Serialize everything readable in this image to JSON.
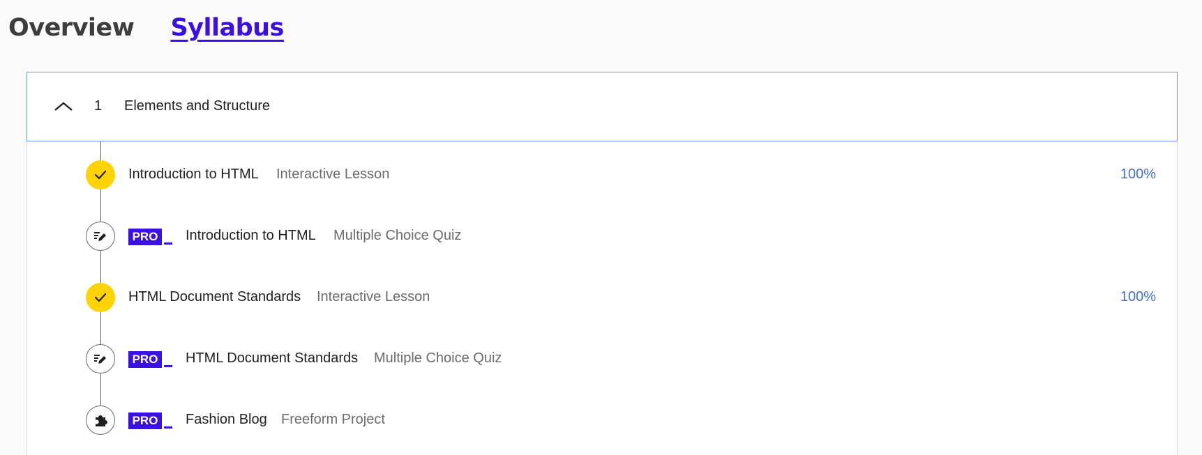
{
  "tabs": [
    {
      "label": "Overview"
    },
    {
      "label": "Syllabus"
    }
  ],
  "module": {
    "number": "1",
    "title": "Elements and Structure"
  },
  "items": [
    {
      "status": "done",
      "pro": false,
      "title": "Introduction to HTML",
      "type": "Interactive Lesson",
      "progress": "100%"
    },
    {
      "status": "quiz",
      "pro": true,
      "pro_label": "PRO",
      "title": "Introduction to HTML",
      "type": "Multiple Choice Quiz"
    },
    {
      "status": "done",
      "pro": false,
      "title": "HTML Document Standards",
      "type": "Interactive Lesson",
      "progress": "100%"
    },
    {
      "status": "quiz",
      "pro": true,
      "pro_label": "PRO",
      "title": "HTML Document Standards",
      "type": "Multiple Choice Quiz"
    },
    {
      "status": "project",
      "pro": true,
      "pro_label": "PRO",
      "title": "Fashion Blog",
      "type": "Freeform Project"
    }
  ],
  "colors": {
    "accent": "#3a10e5",
    "complete": "#ffd300",
    "progress_text": "#3d6fd6",
    "module_border": "#6e96e6"
  },
  "icons": {
    "collapse": "chevron-up-icon",
    "done": "checkmark-icon",
    "quiz": "pencil-list-icon",
    "project": "puzzle-piece-icon"
  }
}
